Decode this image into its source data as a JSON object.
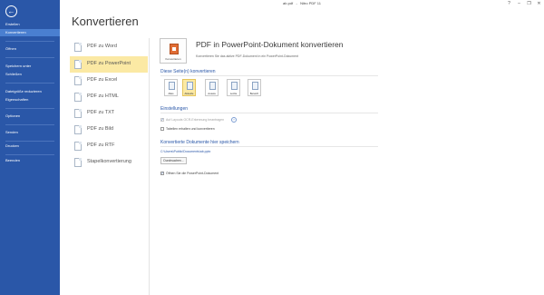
{
  "window": {
    "filename": "ab.pdf",
    "app_title": "Nitro PDF 11",
    "controls": [
      "?",
      "–",
      "❐",
      "✕"
    ]
  },
  "sidebar": {
    "back_glyph": "←",
    "items": [
      {
        "label": "Erstellen",
        "active": false
      },
      {
        "label": "Konvertieren",
        "active": true
      },
      {
        "label": "Öffnen",
        "active": false
      },
      {
        "label": "Speichern unter",
        "active": false
      },
      {
        "label": "Schließen",
        "active": false
      },
      {
        "label": "Dateigröße reduzieren",
        "active": false
      },
      {
        "label": "Eigenschaften",
        "active": false
      },
      {
        "label": "Optionen",
        "active": false
      },
      {
        "label": "Senden",
        "active": false
      },
      {
        "label": "Drucken",
        "active": false
      },
      {
        "label": "Beenden",
        "active": false
      }
    ]
  },
  "main": {
    "heading": "Konvertieren",
    "nav": [
      {
        "label": "PDF zu Word",
        "active": false
      },
      {
        "label": "PDF zu PowerPoint",
        "active": true
      },
      {
        "label": "PDF zu Excel",
        "active": false
      },
      {
        "label": "PDF zu HTML",
        "active": false
      },
      {
        "label": "PDF zu TXT",
        "active": false
      },
      {
        "label": "PDF zu Bild",
        "active": false
      },
      {
        "label": "PDF zu RTF",
        "active": false
      },
      {
        "label": "Stapelkonvertierung",
        "active": false
      }
    ]
  },
  "pane": {
    "icon_caption": "Konvertieren",
    "title": "PDF in PowerPoint-Dokument konvertieren",
    "description": "Konvertieren Sie das aktive PDF-Dokument in ein PowerPoint-Dokument",
    "pages_heading": "Diese Seite(n) konvertieren",
    "page_options": [
      {
        "label": "Alles",
        "active": false
      },
      {
        "label": "Aktuelle",
        "active": true
      },
      {
        "label": "Auswa",
        "active": false
      },
      {
        "label": "Letzte",
        "active": false
      },
      {
        "label": "Bereich",
        "active": false
      }
    ],
    "settings_heading": "Einstellungen",
    "settings": [
      {
        "label": "Auf Layouts   OCR-Erkennung beantragen",
        "checked": true,
        "disabled": true
      },
      {
        "label": "Tabellen erhalten und konvertieren",
        "checked": false,
        "disabled": false
      }
    ],
    "help_glyph": "?",
    "save_heading": "Konvertierte Dokumente hier speichern",
    "save_path": "C:\\Users\\Public\\Documents\\ab.pptx",
    "browse_label": "Durchsuchen...",
    "open_after": {
      "label": "Öffnen Sie die PowerPoint-Dokument",
      "checked": true
    }
  }
}
